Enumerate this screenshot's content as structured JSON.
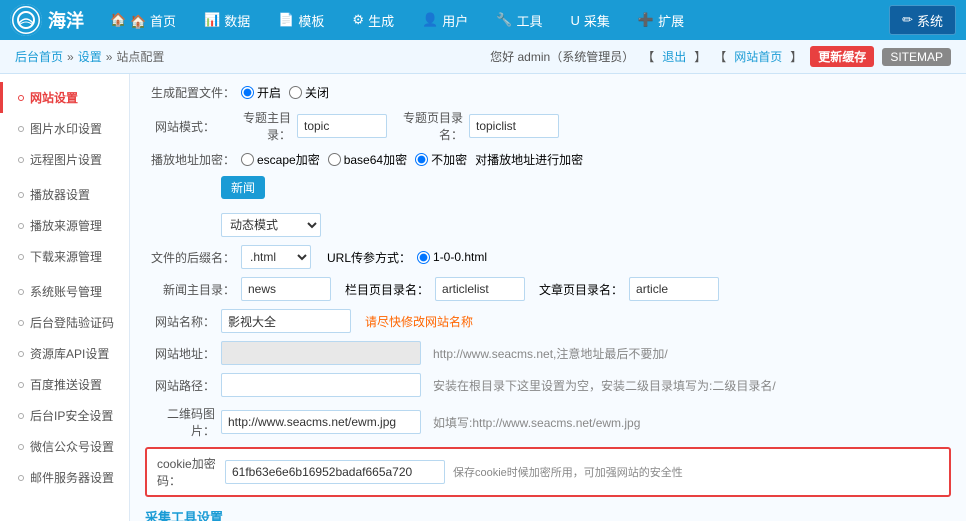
{
  "logo": {
    "text": "海洋",
    "icon": "🌊"
  },
  "nav": {
    "items": [
      {
        "label": "🏠 首页",
        "name": "nav-home"
      },
      {
        "label": "📊 数据",
        "name": "nav-data"
      },
      {
        "label": "📄 模板",
        "name": "nav-template"
      },
      {
        "label": "⚙ 生成",
        "name": "nav-generate"
      },
      {
        "label": "👤 用户",
        "name": "nav-user"
      },
      {
        "label": "🔧 工具",
        "name": "nav-tools"
      },
      {
        "label": "U 采集",
        "name": "nav-collect"
      },
      {
        "label": "➕ 扩展",
        "name": "nav-extend"
      },
      {
        "label": "✏ 系统",
        "name": "nav-system",
        "active": true
      }
    ]
  },
  "breadcrumb": {
    "items": [
      "后台首页",
      "设置",
      "站点配置"
    ],
    "separator": "»",
    "welcome": "您好 admin（系统管理员）",
    "logout": "退出",
    "site_home": "网站首页",
    "btn_update": "更新缓存",
    "btn_sitemap": "SITEMAP"
  },
  "sidebar": {
    "items": [
      {
        "label": "网站设置",
        "active": true,
        "type": "main"
      },
      {
        "label": "图片水印设置",
        "type": "item"
      },
      {
        "label": "远程图片设置",
        "type": "item"
      },
      {
        "label": "播放器设置",
        "type": "item"
      },
      {
        "label": "播放来源管理",
        "type": "item"
      },
      {
        "label": "下载来源管理",
        "type": "item"
      },
      {
        "label": "系统账号管理",
        "type": "item"
      },
      {
        "label": "后台登陆验证码",
        "type": "item"
      },
      {
        "label": "资源库API设置",
        "type": "item"
      },
      {
        "label": "百度推送设置",
        "type": "item"
      },
      {
        "label": "后台IP安全设置",
        "type": "item"
      },
      {
        "label": "微信公众号设置",
        "type": "item"
      },
      {
        "label": "邮件服务器设置",
        "type": "item"
      }
    ]
  },
  "form": {
    "generate_config": "生成配置文件：",
    "generate_options": [
      "开启",
      "关闭"
    ],
    "generate_selected": "开启",
    "site_mode_label": "网站模式：",
    "topic_dir_label": "专题主目录：",
    "topic_dir_value": "topic",
    "topic_list_dir_label": "专题页目录名：",
    "topic_list_dir_value": "topiclist",
    "playurl_encrypt_label": "播放地址加密：",
    "encrypt_options": [
      "escape加密",
      "base64加密",
      "不加密"
    ],
    "encrypt_hint": "对播放地址进行加密",
    "news_tag": "新闻",
    "dynamic_mode_label": "动态模式",
    "file_suffix_label": "文件的后缀名：",
    "file_suffix_value": ".html",
    "url_transfer_label": "URL传参方式：",
    "url_transfer_value": "1-0-0.html",
    "news_dir_label": "新闻主目录：",
    "news_dir_value": "news",
    "column_dir_label": "栏目页目录名：",
    "column_dir_value": "articlelist",
    "article_dir_label": "文章页目录名：",
    "article_dir_value": "article",
    "site_name_label": "网站名称：",
    "site_name_value": "影视大全",
    "site_name_hint": "请尽快修改网站名称",
    "site_url_label": "网站地址：",
    "site_url_value": "",
    "site_url_hint": "http://www.seacms.net,注意地址最后不要加/",
    "site_path_label": "网站路径：",
    "site_path_value": "",
    "site_path_hint": "安装在根目录下这里设置为空，安装二级目录填写为:二级目录名/",
    "qr_code_label": "二维码图片：",
    "qr_code_value": "http://www.seacms.net/ewm.jpg",
    "qr_code_hint": "如填写:http://www.seacms.net/ewm.jpg",
    "cookie_label": "cookie加密码：",
    "cookie_value": "61fb63e6e6b16952badaf665a720",
    "cookie_hint": "保存cookie时候加密所用，可加强网站的安全性",
    "tools_section": "采集工具设置"
  }
}
